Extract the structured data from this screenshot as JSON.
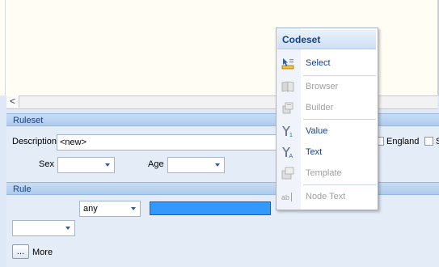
{
  "scroll": {
    "left_arrow": "<"
  },
  "ruleset": {
    "header": "Ruleset",
    "description_label": "Description",
    "description_value": "<new>",
    "england_label": "England",
    "partial_label": "S",
    "sex_label": "Sex",
    "sex_value": "",
    "age_label": "Age",
    "age_value": ""
  },
  "rule": {
    "header": "Rule",
    "any_value": "any",
    "blank_combo_value": "",
    "more_button": "...",
    "more_label": "More"
  },
  "menu": {
    "title": "Codeset",
    "items": [
      {
        "label": "Select",
        "icon": "select-icon",
        "enabled": true
      },
      {
        "label": "Browser",
        "icon": "book-icon",
        "enabled": false
      },
      {
        "label": "Builder",
        "icon": "builder-icon",
        "enabled": false
      },
      {
        "label": "Value",
        "icon": "value-icon",
        "enabled": true
      },
      {
        "label": "Text",
        "icon": "text-icon",
        "enabled": true
      },
      {
        "label": "Template",
        "icon": "template-icon",
        "enabled": false
      },
      {
        "label": "Node Text",
        "icon": "ab-icon",
        "enabled": false
      }
    ]
  }
}
